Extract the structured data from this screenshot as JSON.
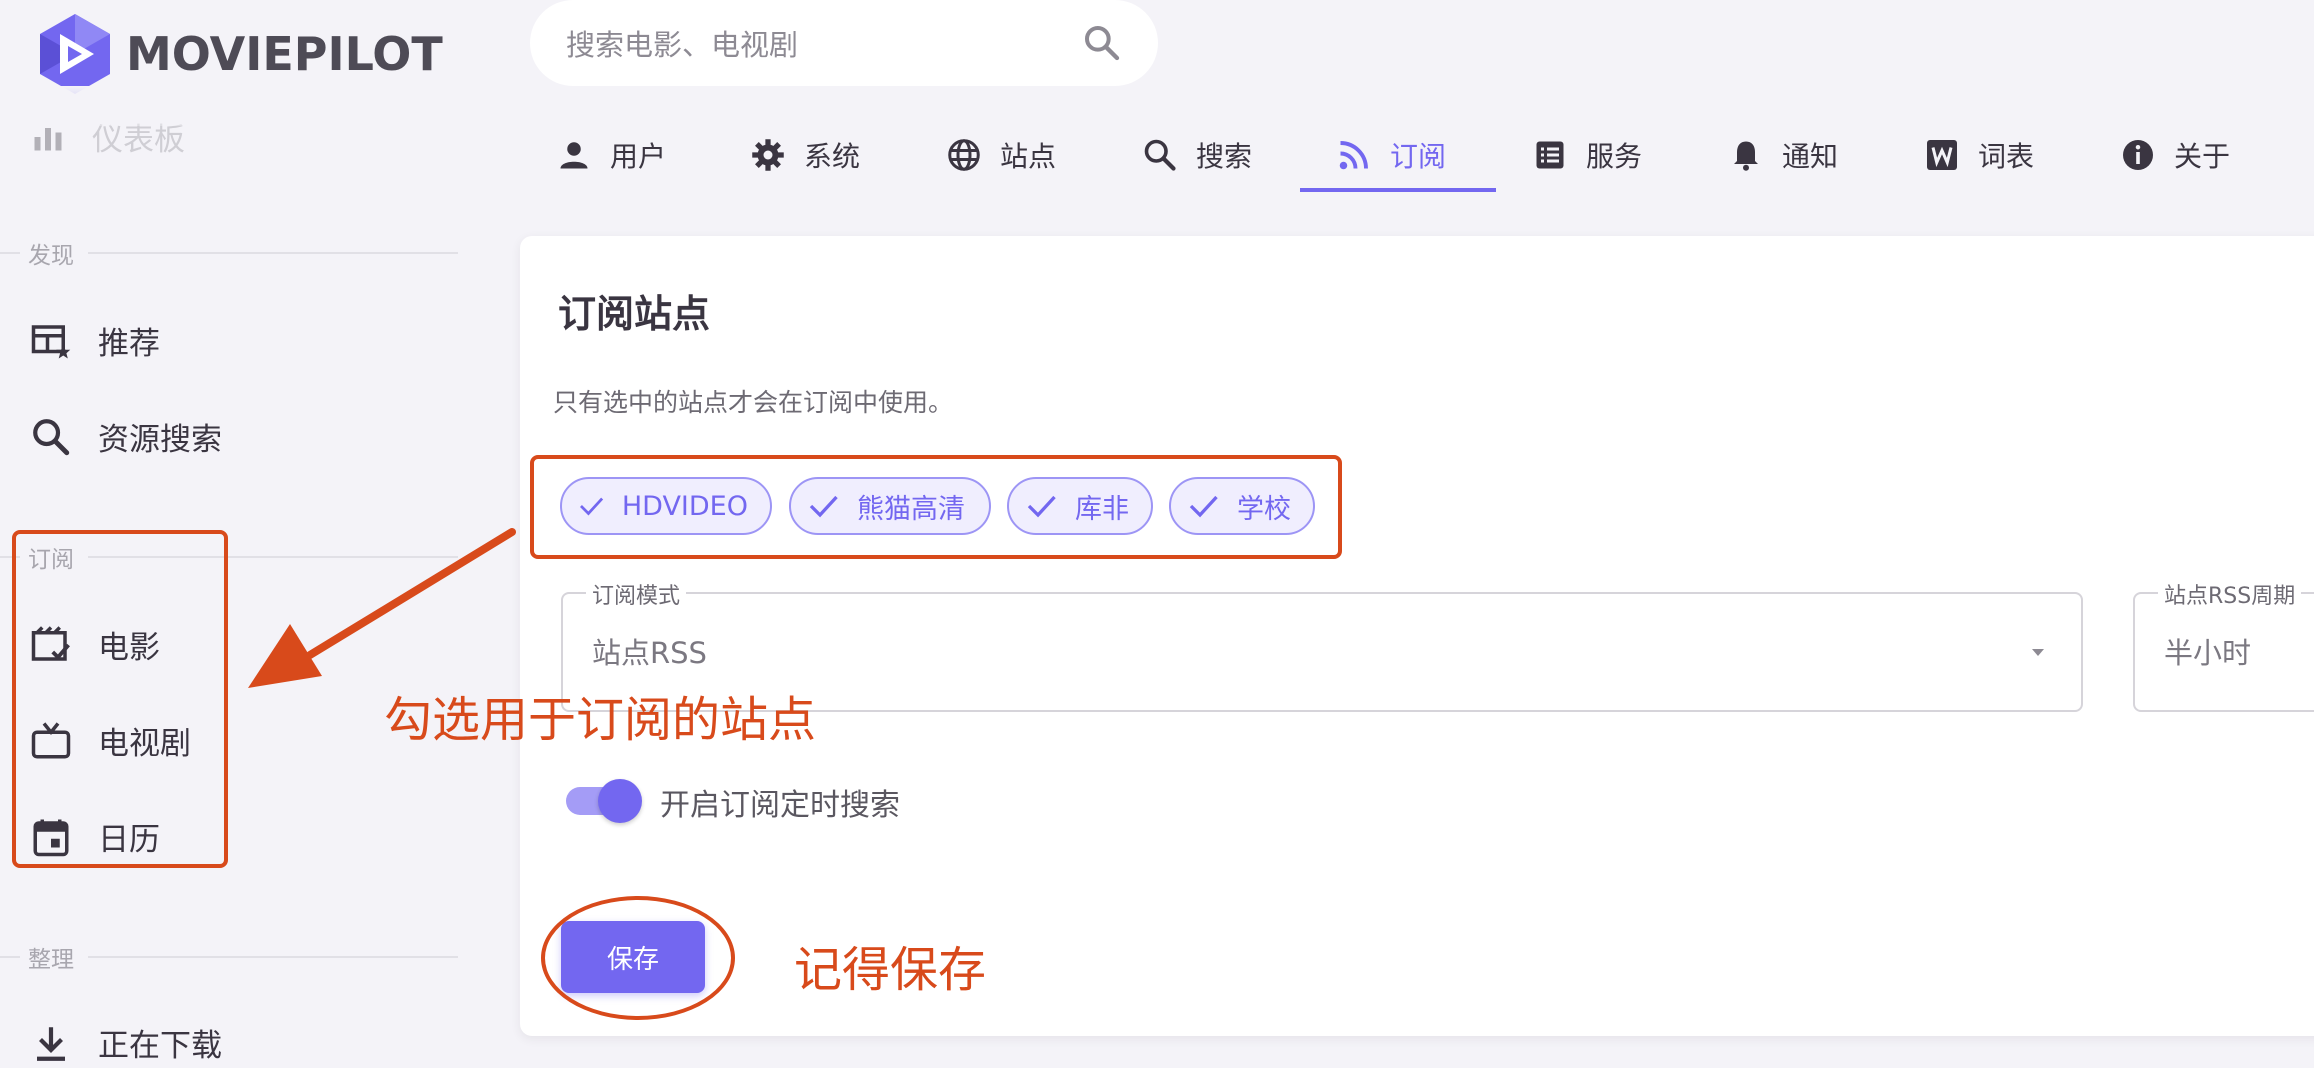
{
  "app": {
    "logo_text": "MOVIEPILOT"
  },
  "search": {
    "placeholder": "搜索电影、电视剧"
  },
  "sidebar": {
    "top_partial_label": "仪表板",
    "sections": [
      {
        "title": "发现"
      },
      {
        "title": "订阅"
      },
      {
        "title": "整理"
      }
    ],
    "items": [
      {
        "label": "推荐",
        "icon": "table-star-icon"
      },
      {
        "label": "资源搜索",
        "icon": "search-icon"
      },
      {
        "label": "电影",
        "icon": "movie-check-icon"
      },
      {
        "label": "电视剧",
        "icon": "tv-icon"
      },
      {
        "label": "日历",
        "icon": "calendar-icon"
      },
      {
        "label": "正在下载",
        "icon": "download-icon"
      }
    ]
  },
  "tabs": [
    {
      "label": "用户",
      "icon": "account-icon"
    },
    {
      "label": "系统",
      "icon": "gear-icon"
    },
    {
      "label": "站点",
      "icon": "globe-icon"
    },
    {
      "label": "搜索",
      "icon": "search-icon"
    },
    {
      "label": "订阅",
      "icon": "rss-icon",
      "active": true
    },
    {
      "label": "服务",
      "icon": "list-icon"
    },
    {
      "label": "通知",
      "icon": "bell-icon"
    },
    {
      "label": "词表",
      "icon": "w-icon"
    },
    {
      "label": "关于",
      "icon": "info-icon"
    }
  ],
  "card": {
    "title": "订阅站点",
    "subtitle": "只有选中的站点才会在订阅中使用。",
    "sites": [
      {
        "label": "HDVIDEO",
        "selected": true
      },
      {
        "label": "熊猫高清",
        "selected": true
      },
      {
        "label": "库非",
        "selected": true
      },
      {
        "label": "学校",
        "selected": true
      }
    ],
    "mode_field": {
      "label": "订阅模式",
      "value": "站点RSS"
    },
    "rss_field": {
      "label": "站点RSS周期",
      "value": "半小时"
    },
    "toggle": {
      "label": "开启订阅定时搜索",
      "on": true
    },
    "save_label": "保存"
  },
  "annotations": {
    "sites_note": "勾选用于订阅的站点",
    "save_note": "记得保存"
  },
  "colors": {
    "accent": "#7367f0",
    "annotation": "#d84a1b",
    "background": "#f4f3f8"
  }
}
